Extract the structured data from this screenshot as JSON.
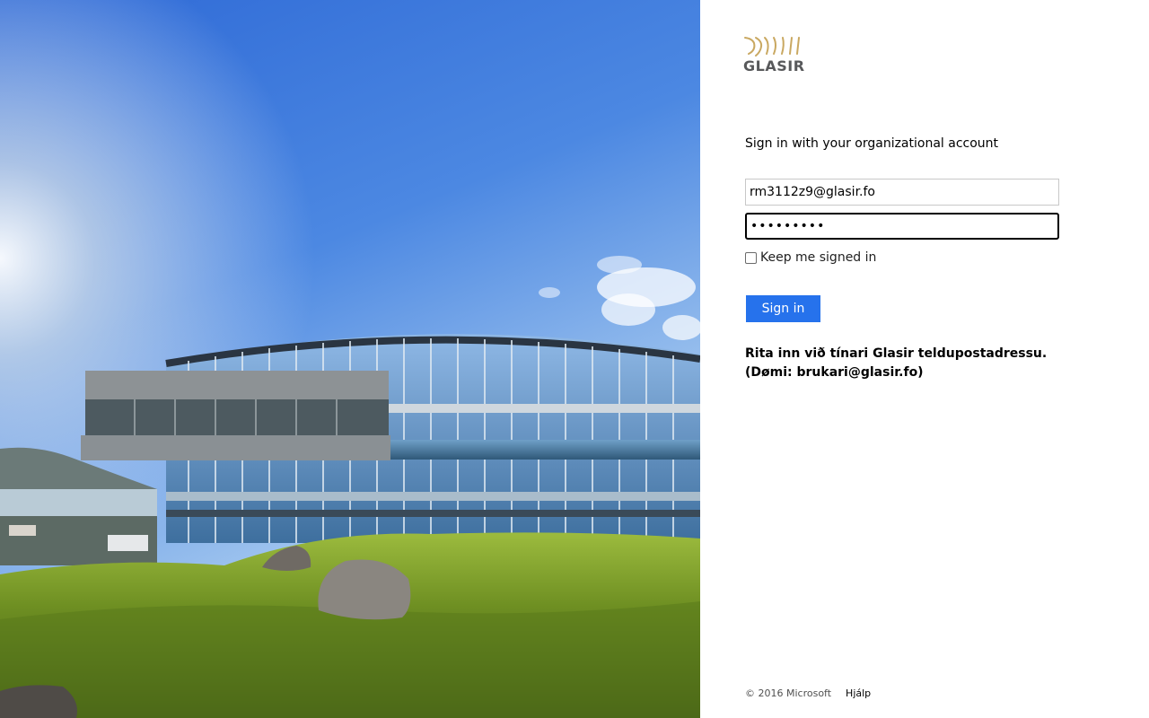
{
  "logo": {
    "text": "GLASIR",
    "color": "#c9a861"
  },
  "form": {
    "heading": "Sign in with your organizational account",
    "username": "rm3112z9@glasir.fo",
    "password_masked": "•••••••••",
    "keep_signed_in_label": "Keep me signed in",
    "keep_signed_in_checked": false,
    "signin_label": "Sign in",
    "hint": "Rita inn við tínari Glasir teldupostadressu. (Dømi: brukari@glasir.fo)"
  },
  "footer": {
    "copyright": "© 2016 Microsoft",
    "help": "Hjálp"
  },
  "colors": {
    "accent": "#2672ec"
  }
}
